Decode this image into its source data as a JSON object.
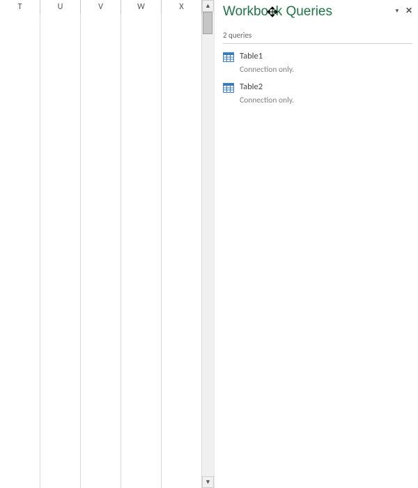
{
  "grid": {
    "columns": [
      "T",
      "U",
      "V",
      "W",
      "X"
    ],
    "row_count": 34
  },
  "pane": {
    "title": "Workbook Queries",
    "summary": "2 queries",
    "queries": [
      {
        "name": "Table1",
        "status": "Connection only."
      },
      {
        "name": "Table2",
        "status": "Connection only."
      }
    ],
    "dropdown_glyph": "▼",
    "close_glyph": "✕"
  },
  "scrollbar": {
    "up_glyph": "▲",
    "down_glyph": "▼"
  }
}
